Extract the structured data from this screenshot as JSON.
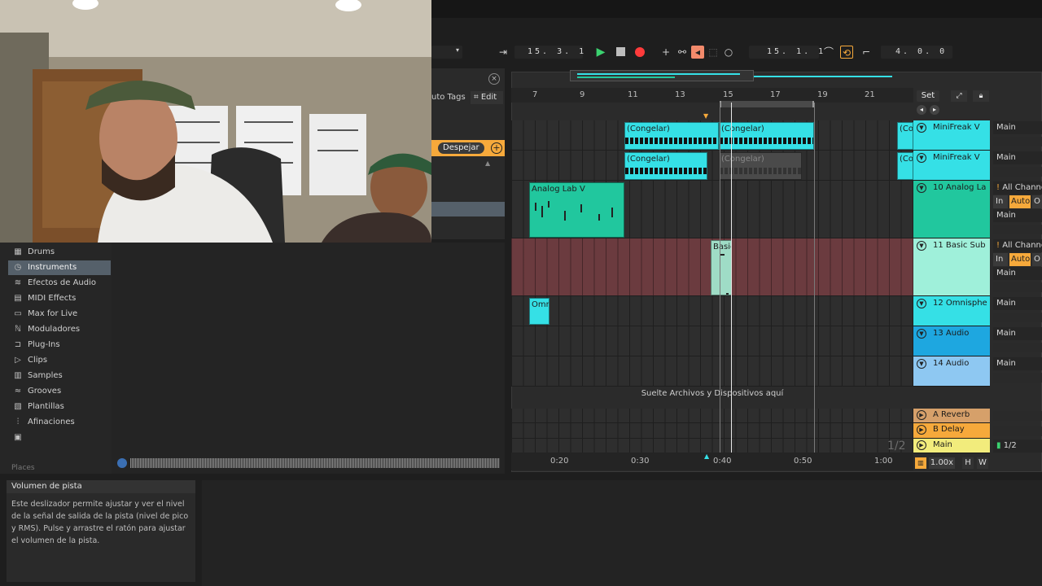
{
  "transport": {
    "arrangement_position": "15. 3. 1",
    "loop_start": "15. 1. 1",
    "loop_length": "4. 0. 0"
  },
  "browser_header": {
    "auto_tags": "uto Tags",
    "edit": "Edit",
    "clear": "Despejar"
  },
  "browser": {
    "items": [
      {
        "label": "Drums",
        "icon": "drum-grid-icon"
      },
      {
        "label": "Instruments",
        "icon": "clock-icon"
      },
      {
        "label": "Efectos de Audio",
        "icon": "waveform-icon"
      },
      {
        "label": "MIDI Effects",
        "icon": "midi-icon"
      },
      {
        "label": "Max for Live",
        "icon": "max-icon"
      },
      {
        "label": "Moduladores",
        "icon": "modulator-icon"
      },
      {
        "label": "Plug-Ins",
        "icon": "plugin-icon"
      },
      {
        "label": "Clips",
        "icon": "clip-icon"
      },
      {
        "label": "Samples",
        "icon": "samples-icon"
      },
      {
        "label": "Grooves",
        "icon": "grooves-icon"
      },
      {
        "label": "Plantillas",
        "icon": "templates-icon"
      },
      {
        "label": "Afinaciones",
        "icon": "tunings-icon"
      }
    ],
    "places_label": "Places",
    "selected": "Instruments"
  },
  "info": {
    "title": "Volumen de pista",
    "text": "Este deslizador permite ajustar y ver el nivel de la señal de salida de la pista (nivel de pico y RMS). Pulse y arrastre el ratón para ajustar el volumen de la pista."
  },
  "ruler": {
    "bars": [
      "7",
      "9",
      "11",
      "13",
      "15",
      "17",
      "19",
      "21"
    ],
    "set_label": "Set"
  },
  "time_axis": {
    "labels": [
      "0:20",
      "0:30",
      "0:40",
      "0:50",
      "1:00"
    ]
  },
  "clips": {
    "row1": [
      "(Congelar)",
      "(Congelar)",
      "(Co"
    ],
    "row2": [
      "(Congelar)",
      "(Congelar)",
      "(Co"
    ],
    "analog": "Analog Lab V",
    "basic": "Basic",
    "omni": "Omn"
  },
  "drop_hint": "Suelte Archivos y Dispositivos aquí",
  "page_indicator": "1/2",
  "tracks": [
    {
      "name": "MiniFreak V",
      "output": "Main",
      "color": "#35e0e6"
    },
    {
      "name": "MiniFreak V",
      "output": "Main",
      "color": "#35e0e6"
    },
    {
      "name": "10 Analog La",
      "input": "All Channe",
      "in": "In",
      "auto": "Auto",
      "o": "O",
      "output": "Main",
      "color": "#21c79e"
    },
    {
      "name": "11 Basic Sub",
      "input": "All Channe",
      "in": "In",
      "auto": "Auto",
      "o": "O",
      "output": "Main",
      "color": "#9ff0da"
    },
    {
      "name": "12 Omnisphe",
      "output": "Main",
      "color": "#35e0e6"
    },
    {
      "name": "13 Audio",
      "output": "Main",
      "color": "#1ea7e0"
    },
    {
      "name": "14 Audio",
      "output": "Main",
      "color": "#8ec8f2"
    }
  ],
  "returns": [
    {
      "name": "A Reverb",
      "color": "#d6a06a"
    },
    {
      "name": "B Delay",
      "color": "#f6a93b"
    },
    {
      "name": "Main",
      "color": "#f2ec7c",
      "output": "1/2"
    }
  ],
  "zoom": {
    "value": "1.00x",
    "h": "H",
    "w": "W"
  }
}
